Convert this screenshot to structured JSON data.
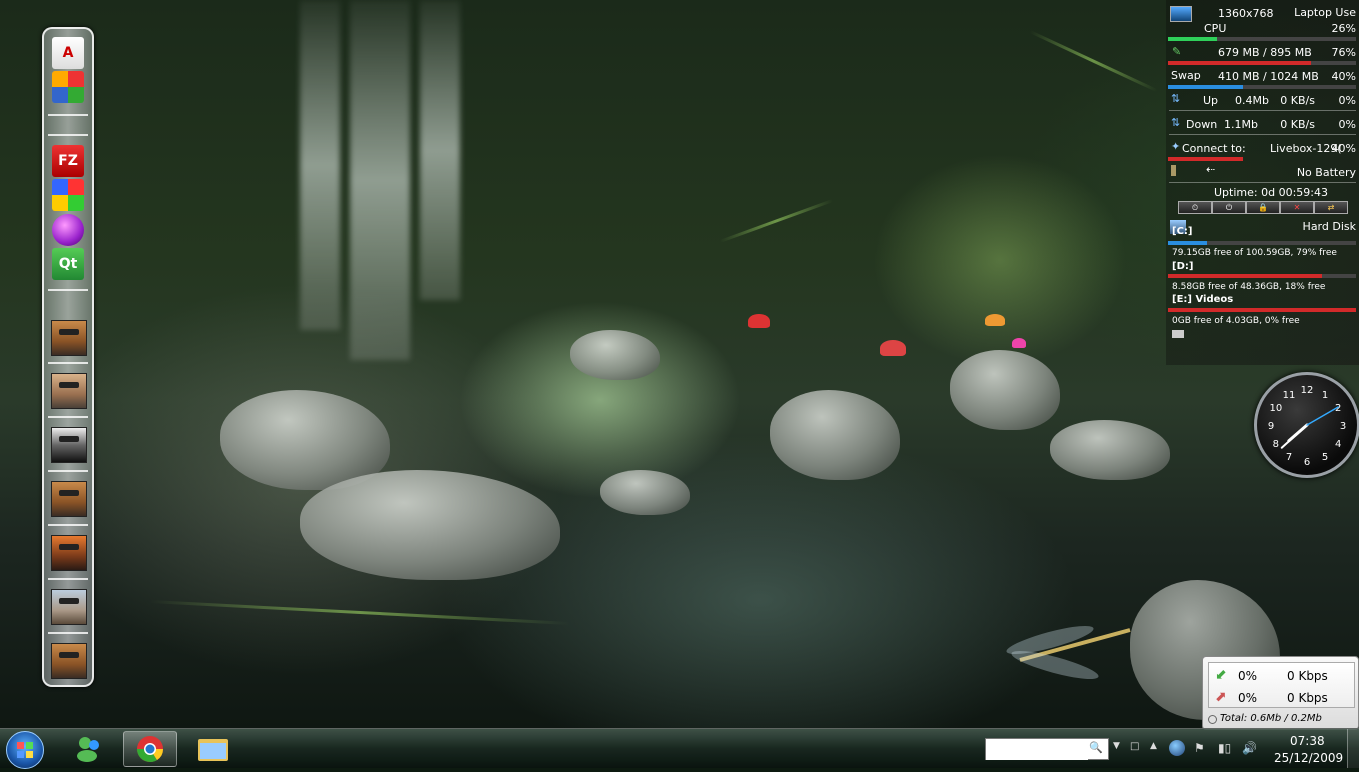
{
  "sidebar": {
    "resolution": "1360x768",
    "profile": "Laptop Use",
    "cpu": {
      "label": "CPU",
      "value": "26%",
      "fraction": 0.26
    },
    "memory": {
      "value": "679 MB / 895 MB",
      "percent": "76%",
      "fraction": 0.76
    },
    "swap": {
      "label": "Swap",
      "value": "410 MB / 1024 MB",
      "percent": "40%",
      "fraction": 0.4
    },
    "up": {
      "label": "Up",
      "total": "0.4Mb",
      "rate": "0 KB/s",
      "percent": "0%"
    },
    "down": {
      "label": "Down",
      "total": "1.1Mb",
      "rate": "0 KB/s",
      "percent": "0%"
    },
    "wifi": {
      "label": "Connect to:",
      "network": "Livebox-129(",
      "percent": "40%",
      "fraction": 0.4
    },
    "battery": {
      "value": "No Battery"
    },
    "uptime": "Uptime: 0d 00:59:43",
    "harddisk_title": "Hard Disk",
    "drives": [
      {
        "label": "[C:]",
        "info": "79.15GB free of 100.59GB, 79% free",
        "fraction": 0.21
      },
      {
        "label": "[D:]",
        "info": "8.58GB free of 48.36GB, 18% free",
        "fraction": 0.82
      },
      {
        "label": "[E:] Videos",
        "info": "0GB free of 4.03GB, 0% free",
        "fraction": 1.0
      }
    ]
  },
  "clock": {
    "hour_numbers": [
      "12",
      "1",
      "2",
      "3",
      "4",
      "5",
      "6",
      "7",
      "8",
      "9",
      "10",
      "11"
    ],
    "time": "07:38"
  },
  "netmeter": {
    "down_percent": "0%",
    "down_rate": "0 Kbps",
    "up_percent": "0%",
    "up_rate": "0 Kbps",
    "total": "Total: 0.6Mb / 0.2Mb"
  },
  "taskbar": {
    "time": "07:38",
    "date": "25/12/2009",
    "search_placeholder": ""
  },
  "dock": {
    "icons": [
      "adobe-reader-icon",
      "office-icon",
      "filezilla-icon",
      "windows-icon",
      "orb-icon",
      "qt-creator-icon"
    ],
    "filezilla_text": "FZ",
    "qt_text": "Qt",
    "avatars": 7
  },
  "colors": {
    "cpu_bar": "#2fd05a",
    "mem_bar": "#d22a2a",
    "swap_bar": "#2a8ee0",
    "disk_c": "#2a8ee0",
    "disk_red": "#d22a2a"
  }
}
